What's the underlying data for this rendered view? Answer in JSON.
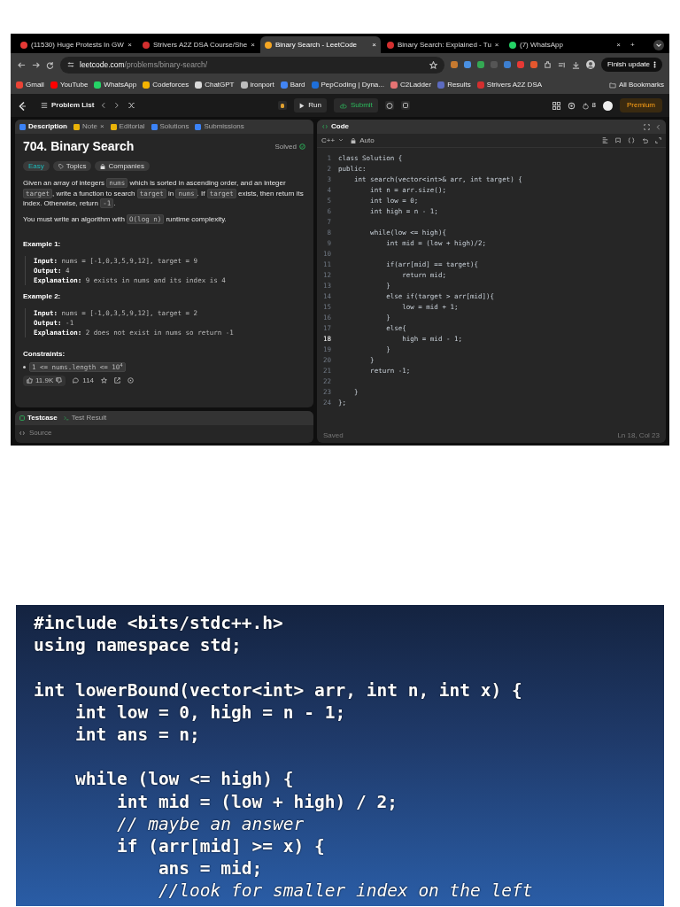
{
  "browser": {
    "tabs": [
      {
        "title": "(11530) Huge Protests In GW",
        "color": "#e53935",
        "close": "×",
        "selected": false
      },
      {
        "title": "Strivers A2Z DSA Course/She",
        "color": "#d32f2f",
        "close": "×",
        "selected": false
      },
      {
        "title": "Binary Search - LeetCode",
        "color": "#f5a623",
        "close": "×",
        "selected": true
      },
      {
        "title": "Binary Search: Explained - Tu",
        "color": "#d32f2f",
        "close": "×",
        "selected": false
      },
      {
        "title": "(7) WhatsApp",
        "color": "#25d366",
        "close": "×",
        "selected": false
      }
    ],
    "new_tab": "+",
    "url": {
      "host": "leetcode.com",
      "path": "/problems/binary-search/"
    },
    "update_button": "Finish update",
    "bookmarks": [
      {
        "label": "Gmail",
        "color": "#ea4335"
      },
      {
        "label": "YouTube",
        "color": "#ff0000"
      },
      {
        "label": "WhatsApp",
        "color": "#25d366"
      },
      {
        "label": "Codeforces",
        "color": "#f5b400"
      },
      {
        "label": "ChatGPT",
        "color": "#d9d9d9"
      },
      {
        "label": "ironport",
        "color": "#bdbdbd"
      },
      {
        "label": "Bard",
        "color": "#4285f4"
      },
      {
        "label": "PepCoding | Dyna...",
        "color": "#1e6fd9"
      },
      {
        "label": "C2Ladder",
        "color": "#e57373"
      },
      {
        "label": "Results",
        "color": "#5c6bc0"
      },
      {
        "label": "Strivers A2Z DSA",
        "color": "#d32f2f"
      }
    ],
    "all_bookmarks": "All Bookmarks"
  },
  "nav": {
    "problem_list": "Problem List",
    "run": "Run",
    "submit": "Submit",
    "streak": "8",
    "premium": "Premium"
  },
  "description": {
    "tabs": [
      {
        "label": "Description",
        "color": "#3b82f6",
        "selected": true
      },
      {
        "label": "Note",
        "color": "#eab308",
        "close": "×",
        "selected": false
      },
      {
        "label": "Editorial",
        "color": "#eab308",
        "selected": false
      },
      {
        "label": "Solutions",
        "color": "#3b82f6",
        "selected": false
      },
      {
        "label": "Submissions",
        "color": "#3b82f6",
        "selected": false
      }
    ],
    "title": "704. Binary Search",
    "status": "Solved",
    "tags": [
      {
        "label": "Easy",
        "kind": "difficulty"
      },
      {
        "label": "Topics",
        "kind": "topics"
      },
      {
        "label": "Companies",
        "kind": "companies"
      }
    ],
    "paragraphs": [
      [
        {
          "kind": "text",
          "text": "Given an array of integers "
        },
        {
          "kind": "code",
          "text": "nums"
        },
        {
          "kind": "text",
          "text": " which is sorted in ascending order, and an integer "
        },
        {
          "kind": "code",
          "text": "target"
        },
        {
          "kind": "text",
          "text": ", write a function to search "
        },
        {
          "kind": "code",
          "text": "target"
        },
        {
          "kind": "text",
          "text": " in "
        },
        {
          "kind": "code",
          "text": "nums"
        },
        {
          "kind": "text",
          "text": ". If "
        },
        {
          "kind": "code",
          "text": "target"
        },
        {
          "kind": "text",
          "text": " exists, then return its index. Otherwise, return "
        },
        {
          "kind": "code",
          "text": "-1"
        },
        {
          "kind": "text",
          "text": "."
        }
      ],
      [
        {
          "kind": "text",
          "text": "You must write an algorithm with "
        },
        {
          "kind": "code",
          "text": "O(log n)"
        },
        {
          "kind": "text",
          "text": " runtime complexity."
        }
      ]
    ],
    "examples": [
      {
        "heading": "Example 1:",
        "lines": [
          "**Input:** nums = [-1,0,3,5,9,12], target = 9",
          "**Output:** 4",
          "**Explanation:** 9 exists in nums and its index is 4"
        ]
      },
      {
        "heading": "Example 2:",
        "lines": [
          "**Input:** nums = [-1,0,3,5,9,12], target = 2",
          "**Output:** -1",
          "**Explanation:** 2 does not exist in nums so return -1"
        ]
      }
    ],
    "constraints_heading": "Constraints:",
    "constraints": [
      "1 <= nums.length <= 10$^{4}$"
    ],
    "likes": "11.9K",
    "comments": "114"
  },
  "console": {
    "tabs": [
      {
        "label": "Testcase",
        "selected": true
      },
      {
        "label": "Test Result",
        "selected": false
      }
    ],
    "source": "Source"
  },
  "editor": {
    "title": "Code",
    "language": "C++",
    "mode": "Auto",
    "lines": [
      {
        "no": "1",
        "code": "class Solution {",
        "active": false
      },
      {
        "no": "2",
        "code": "public:",
        "active": false
      },
      {
        "no": "3",
        "code": "    int search(vector<int>& arr, int target) {",
        "active": false
      },
      {
        "no": "4",
        "code": "        int n = arr.size();",
        "active": false
      },
      {
        "no": "5",
        "code": "        int low = 0;",
        "active": false
      },
      {
        "no": "6",
        "code": "        int high = n - 1;",
        "active": false
      },
      {
        "no": "7",
        "active": false
      },
      {
        "no": "8",
        "code": "        while(low <= high){",
        "active": false
      },
      {
        "no": "9",
        "code": "            int mid = (low + high)/2;",
        "active": false
      },
      {
        "no": "10",
        "active": false
      },
      {
        "no": "11",
        "code": "            if(arr[mid] == target){",
        "active": false
      },
      {
        "no": "12",
        "code": "                return mid;",
        "active": false
      },
      {
        "no": "13",
        "code": "            }",
        "active": false
      },
      {
        "no": "14",
        "code": "            else if(target > arr[mid]){",
        "active": false
      },
      {
        "no": "15",
        "code": "                low = mid + 1;",
        "active": false
      },
      {
        "no": "16",
        "code": "            }",
        "active": false
      },
      {
        "no": "17",
        "code": "            else{",
        "active": false
      },
      {
        "no": "18",
        "code": "                high = mid - 1;",
        "active": true
      },
      {
        "no": "19",
        "code": "            }",
        "active": false
      },
      {
        "no": "20",
        "code": "        }",
        "active": false
      },
      {
        "no": "21",
        "code": "        return -1;",
        "active": false
      },
      {
        "no": "22",
        "active": false
      },
      {
        "no": "23",
        "code": "    }",
        "active": false
      },
      {
        "no": "24",
        "code": "};",
        "active": false
      }
    ],
    "status": "Saved",
    "position": "Ln 18, Col 23"
  },
  "video": {
    "lines": [
      {
        "kind": "code",
        "text": "#include <bits/stdc++.h>"
      },
      {
        "kind": "code",
        "text": "using namespace std;"
      },
      {
        "kind": "blank"
      },
      {
        "kind": "code",
        "text": "int lowerBound(vector<int> arr, int n, int x) {"
      },
      {
        "kind": "code",
        "text": "    int low = 0, high = n - 1;"
      },
      {
        "kind": "code",
        "text": "    int ans = n;"
      },
      {
        "kind": "blank"
      },
      {
        "kind": "code",
        "text": "    while (low <= high) {"
      },
      {
        "kind": "code",
        "text": "        int mid = (low + high) / 2;"
      },
      {
        "kind": "comment",
        "text": "        // maybe an answer"
      },
      {
        "kind": "code",
        "text": "        if (arr[mid] >= x) {"
      },
      {
        "kind": "code",
        "text": "            ans = mid;"
      },
      {
        "kind": "comment",
        "text": "            //look for smaller index on the left"
      }
    ]
  }
}
